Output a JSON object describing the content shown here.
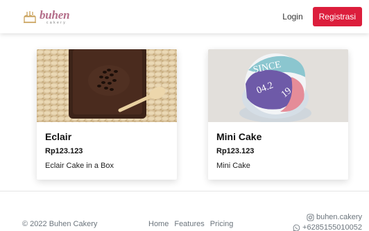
{
  "navbar": {
    "brand_name": "buhen",
    "brand_sub": "cakery",
    "login_label": "Login",
    "register_label": "Registrasi",
    "accent_color": "#dc1e3c"
  },
  "products": [
    {
      "title": "Eclair",
      "price": "Rp123.123",
      "description": "Eclair Cake in a Box",
      "image": "chocolate-box-on-woven-mat"
    },
    {
      "title": "Mini Cake",
      "price": "Rp123.123",
      "description": "Mini Cake",
      "image": "pastel-bento-cake"
    }
  ],
  "footer": {
    "copyright": "© 2022 Buhen Cakery",
    "links": [
      "Home",
      "Features",
      "Pricing"
    ],
    "instagram": "buhen.cakery",
    "whatsapp": "+6285155010052"
  }
}
